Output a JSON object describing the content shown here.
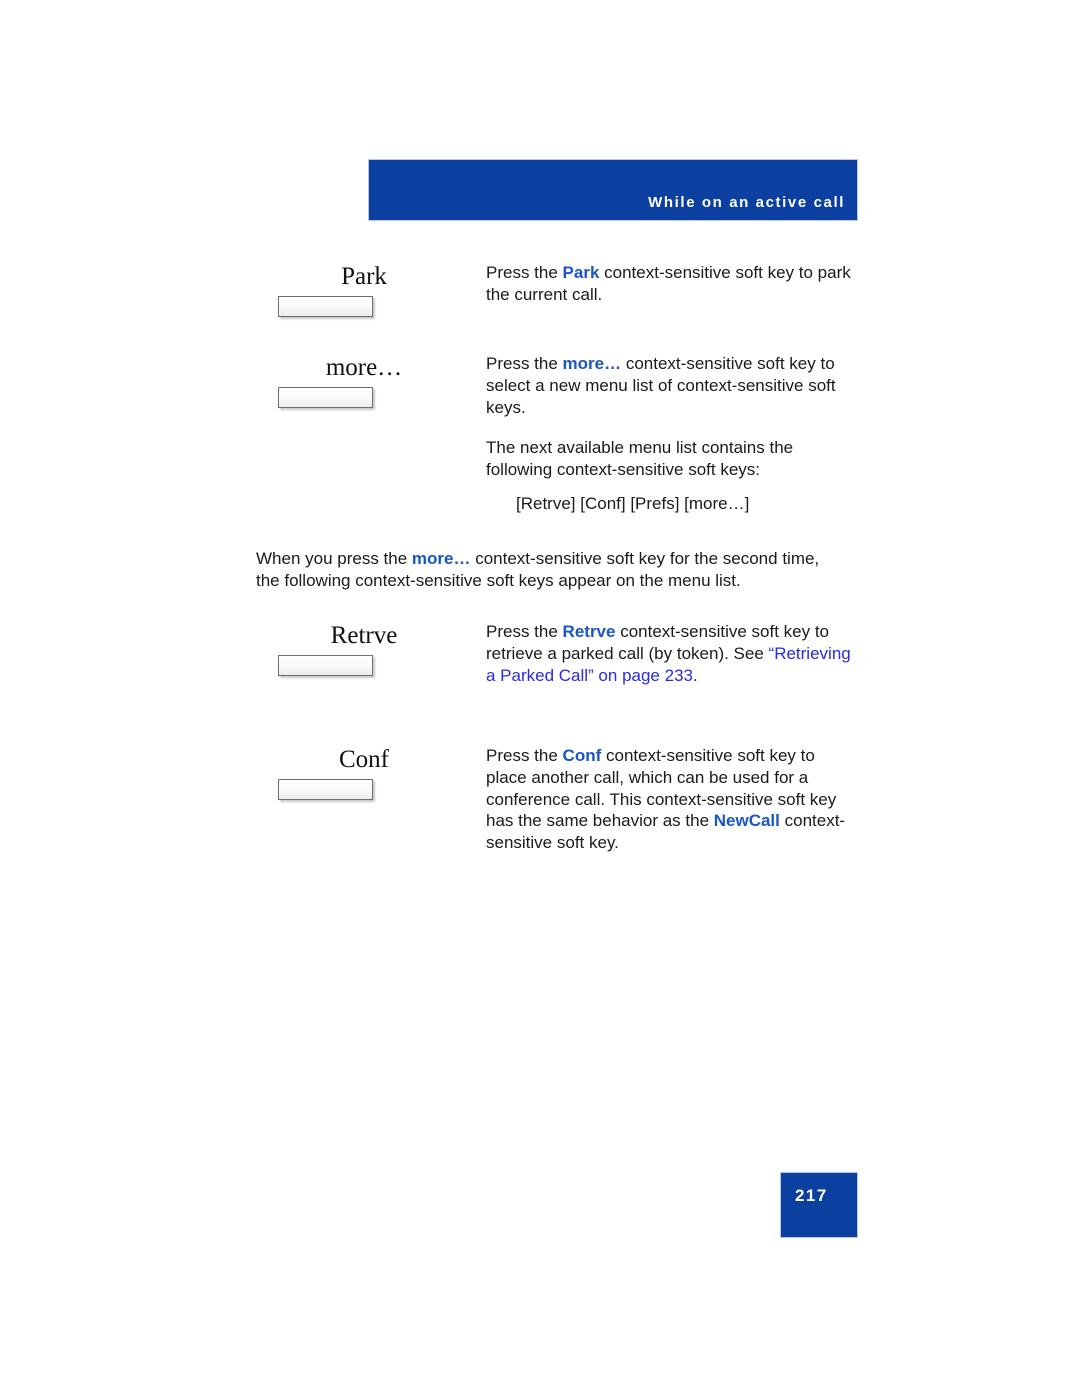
{
  "header": {
    "title": "While on an active call"
  },
  "rows": [
    {
      "key_label": "Park",
      "paragraphs": [
        {
          "segments": [
            {
              "text": "Press the ",
              "style": "normal"
            },
            {
              "text": "Park",
              "style": "keyword"
            },
            {
              "text": " context-sensitive soft key to park the current call.",
              "style": "normal"
            }
          ]
        }
      ]
    },
    {
      "key_label": "more…",
      "paragraphs": [
        {
          "segments": [
            {
              "text": "Press the ",
              "style": "normal"
            },
            {
              "text": "more…",
              "style": "keyword"
            },
            {
              "text": " context-sensitive soft key to select a new menu list of context-sensitive soft keys.",
              "style": "normal"
            }
          ]
        },
        {
          "segments": [
            {
              "text": "The next available menu list contains the following context-sensitive soft keys:",
              "style": "normal"
            }
          ]
        },
        {
          "indent": true,
          "segments": [
            {
              "text": "[Retrve] [Conf] [Prefs] [more…]",
              "style": "normal"
            }
          ]
        }
      ]
    },
    {
      "key_label": "Retrve",
      "paragraphs": [
        {
          "segments": [
            {
              "text": "Press the ",
              "style": "normal"
            },
            {
              "text": "Retrve",
              "style": "keyword"
            },
            {
              "text": " context-sensitive soft key to retrieve a parked call (by token). See ",
              "style": "normal"
            },
            {
              "text": "“Retrieving a Parked Call” on page 233",
              "style": "link"
            },
            {
              "text": ".",
              "style": "normal"
            }
          ]
        }
      ]
    },
    {
      "key_label": "Conf",
      "paragraphs": [
        {
          "segments": [
            {
              "text": "Press the ",
              "style": "normal"
            },
            {
              "text": "Conf",
              "style": "keyword"
            },
            {
              "text": " context-sensitive soft key to place another call, which can be used for a conference call. This context-sensitive soft key has the same behavior as the ",
              "style": "normal"
            },
            {
              "text": "NewCall",
              "style": "keyword"
            },
            {
              "text": " context-sensitive soft key.",
              "style": "normal"
            }
          ]
        }
      ]
    }
  ],
  "body_paragraph": {
    "segments": [
      {
        "text": "When you press the ",
        "style": "normal"
      },
      {
        "text": "more…",
        "style": "keyword"
      },
      {
        "text": " context-sensitive soft key for the second time, the following context-sensitive soft keys appear on the menu list.",
        "style": "normal"
      }
    ]
  },
  "page_number": "217",
  "colors": {
    "brand_blue": "#0B3FA0",
    "keyword_blue": "#1a56c4",
    "link_blue": "#2a2ae0"
  }
}
